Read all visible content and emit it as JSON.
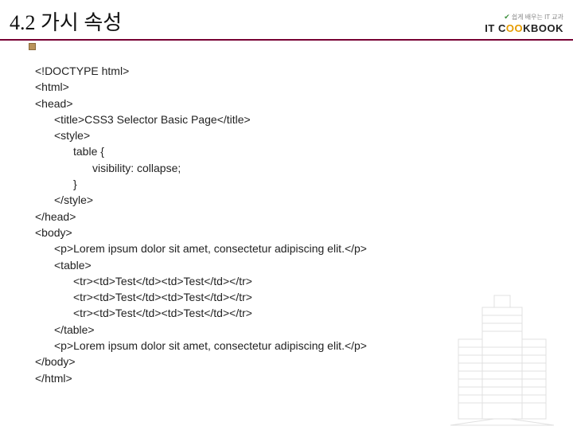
{
  "header": {
    "title": "4.2 가시 속성",
    "logo_top": "쉽게 배우는 IT 교과",
    "logo_text_pre": "IT C",
    "logo_text_mid": "OO",
    "logo_text_post": "KBOOK"
  },
  "code": {
    "lines": [
      {
        "indent": 0,
        "text": "<!DOCTYPE html>"
      },
      {
        "indent": 0,
        "text": "<html>"
      },
      {
        "indent": 0,
        "text": "<head>"
      },
      {
        "indent": 1,
        "text": "<title>CSS3 Selector Basic Page</title>"
      },
      {
        "indent": 1,
        "text": "<style>"
      },
      {
        "indent": 2,
        "text": "table {"
      },
      {
        "indent": 3,
        "text": "visibility: collapse;"
      },
      {
        "indent": 2,
        "text": "}"
      },
      {
        "indent": 1,
        "text": "</style>"
      },
      {
        "indent": 0,
        "text": "</head>"
      },
      {
        "indent": 0,
        "text": "<body>"
      },
      {
        "indent": 1,
        "text": "<p>Lorem ipsum dolor sit amet, consectetur adipiscing elit.</p>"
      },
      {
        "indent": 1,
        "text": "<table>"
      },
      {
        "indent": 2,
        "text": "<tr><td>Test</td><td>Test</td></tr>"
      },
      {
        "indent": 2,
        "text": "<tr><td>Test</td><td>Test</td></tr>"
      },
      {
        "indent": 2,
        "text": "<tr><td>Test</td><td>Test</td></tr>"
      },
      {
        "indent": 1,
        "text": "</table>"
      },
      {
        "indent": 1,
        "text": "<p>Lorem ipsum dolor sit amet, consectetur adipiscing elit.</p>"
      },
      {
        "indent": 0,
        "text": "</body>"
      },
      {
        "indent": 0,
        "text": "</html>"
      }
    ]
  }
}
